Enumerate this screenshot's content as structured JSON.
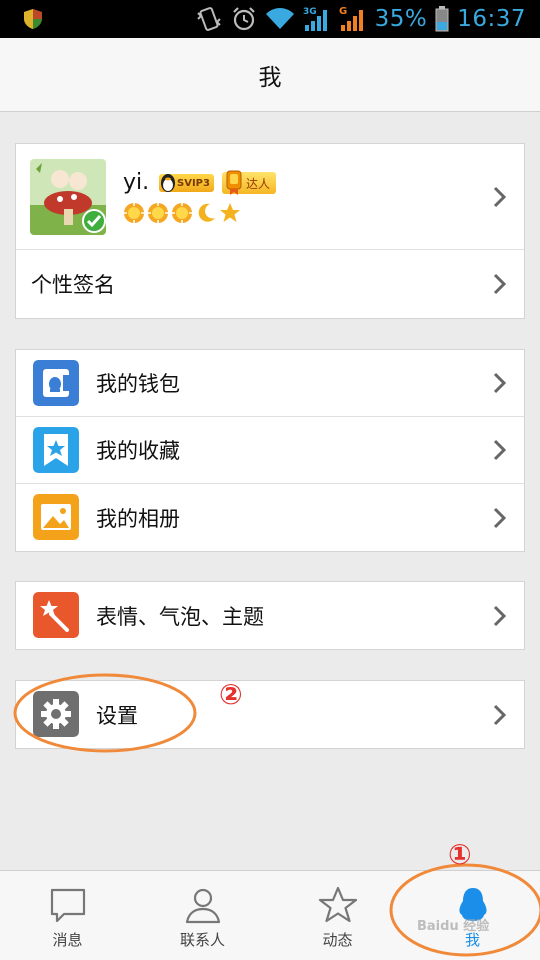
{
  "status_bar": {
    "battery_percent": "35%",
    "time": "16:37",
    "network_1": "3G",
    "network_2": "G",
    "accent_color": "#39a9e0"
  },
  "header": {
    "title": "我"
  },
  "profile": {
    "nickname": "yi.",
    "svip_badge": "SVIP3",
    "daren_badge": "达人",
    "level_icons": [
      "sun-icon",
      "sun-icon",
      "sun-icon",
      "moon-icon",
      "star-icon"
    ]
  },
  "signature": {
    "label": "个性签名"
  },
  "menu_group_1": [
    {
      "label": "我的钱包",
      "icon": "wallet-icon",
      "color": "#3a7fd5"
    },
    {
      "label": "我的收藏",
      "icon": "bookmark-star-icon",
      "color": "#2aa3e8"
    },
    {
      "label": "我的相册",
      "icon": "photo-icon",
      "color": "#f5a21b"
    }
  ],
  "menu_group_2": [
    {
      "label": "表情、气泡、主题",
      "icon": "magic-wand-icon",
      "color": "#e9572c"
    }
  ],
  "menu_group_3": [
    {
      "label": "设置",
      "icon": "gear-icon",
      "color": "#6f6f6f"
    }
  ],
  "tab_bar": [
    {
      "label": "消息",
      "icon": "chat-bubble-icon",
      "active": false
    },
    {
      "label": "联系人",
      "icon": "contacts-icon",
      "active": false
    },
    {
      "label": "动态",
      "icon": "star-icon",
      "active": false
    },
    {
      "label": "我",
      "icon": "penguin-icon",
      "active": true
    }
  ],
  "annotations": {
    "step_1": "①",
    "step_2": "②",
    "color": "#e5322d"
  },
  "watermark": "Baidu 经验"
}
